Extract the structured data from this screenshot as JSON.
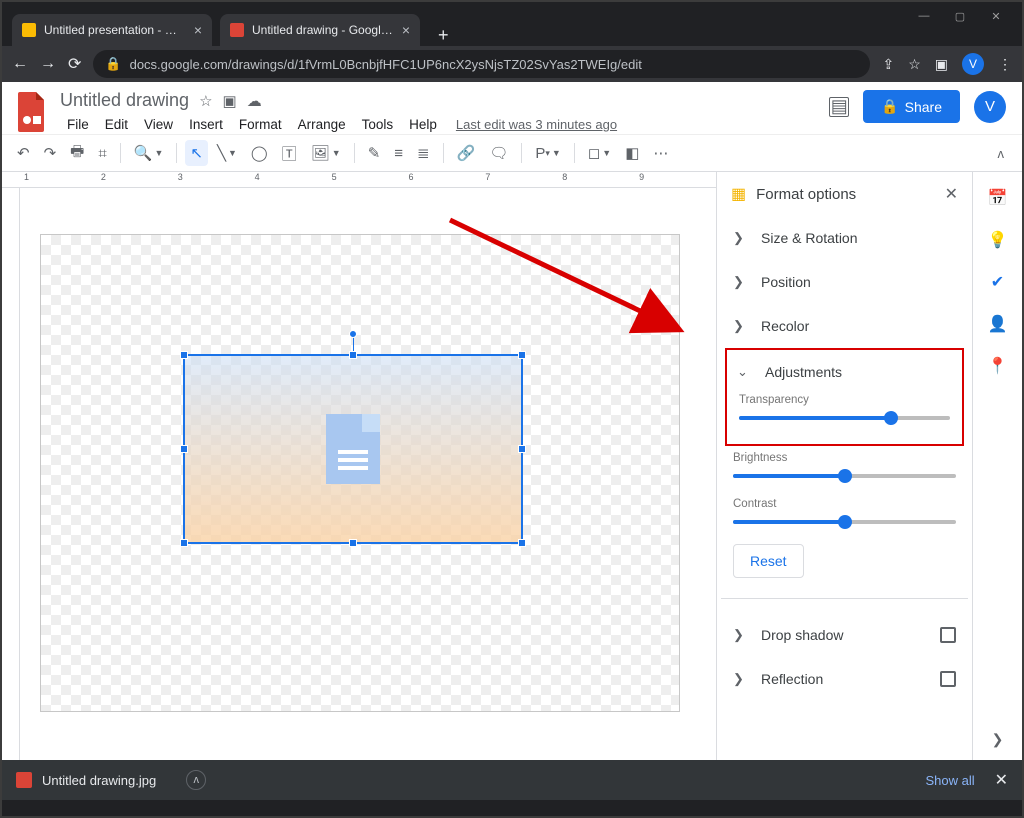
{
  "browser": {
    "tabs": [
      {
        "title": "Untitled presentation - Google S"
      },
      {
        "title": "Untitled drawing - Google Draw"
      }
    ],
    "url": "docs.google.com/drawings/d/1fVrmL0BcnbjfHFC1UP6ncX2ysNjsTZ02SvYas2TWEIg/edit",
    "avatar_letter": "V"
  },
  "doc": {
    "title": "Untitled drawing",
    "last_edit": "Last edit was 3 minutes ago",
    "menus": [
      "File",
      "Edit",
      "View",
      "Insert",
      "Format",
      "Arrange",
      "Tools",
      "Help"
    ],
    "share_label": "Share",
    "avatar_letter": "V"
  },
  "toolbar": {
    "font_label": "P"
  },
  "ruler_marks": [
    "1",
    "2",
    "3",
    "4",
    "5",
    "6",
    "7",
    "8",
    "9"
  ],
  "format_panel": {
    "title": "Format options",
    "sections": {
      "size_rotation": "Size & Rotation",
      "position": "Position",
      "recolor": "Recolor",
      "adjustments": "Adjustments",
      "drop_shadow": "Drop shadow",
      "reflection": "Reflection"
    },
    "sliders": {
      "transparency": {
        "label": "Transparency",
        "percent": 72
      },
      "brightness": {
        "label": "Brightness",
        "percent": 50
      },
      "contrast": {
        "label": "Contrast",
        "percent": 50
      }
    },
    "reset_label": "Reset"
  },
  "download_bar": {
    "file": "Untitled drawing.jpg",
    "show_all": "Show all"
  }
}
